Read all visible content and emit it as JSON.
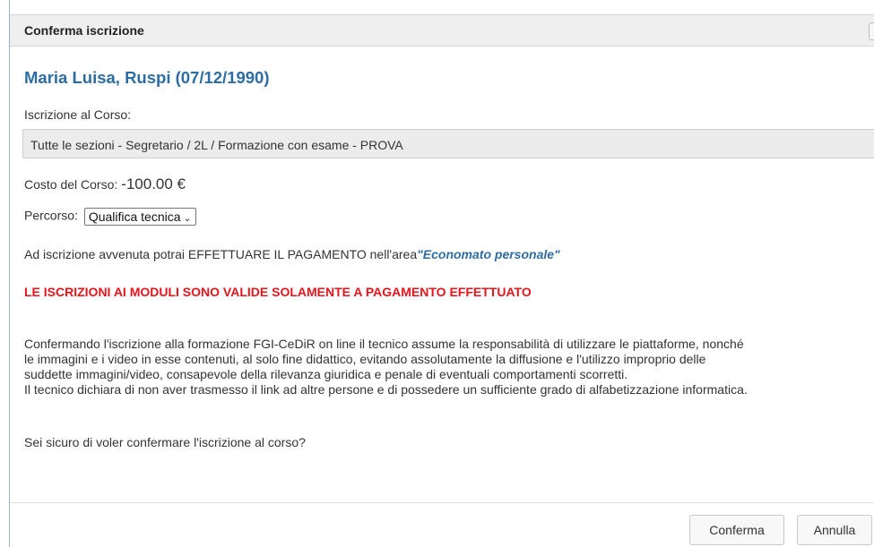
{
  "dialog": {
    "title": "Conferma iscrizione",
    "student_name": "Maria Luisa, Ruspi (07/12/1990)",
    "course_label": "Iscrizione al Corso:",
    "course_value": "Tutte le sezioni - Segretario / 2L / Formazione con esame - PROVA",
    "cost_label": "Costo del Corso: ",
    "cost_value": "-100.00 €",
    "path_label": "Percorso: ",
    "path_selected": "Qualifica tecnica",
    "payment_text": "Ad iscrizione avvenuta potrai EFFETTUARE IL PAGAMENTO nell'area",
    "payment_link": "\"Economato personale\"",
    "warning": "LE ISCRIZIONI AI MODULI SONO VALIDE SOLAMENTE A PAGAMENTO EFFETTUATO",
    "disclaimer_lines": [
      "Confermando l'iscrizione alla formazione FGI-CeDiR on line il tecnico assume la responsabilità di utilizzare le piattaforme, nonché",
      "le immagini e i video in esse contenuti, al solo fine didattico, evitando assolutamente la diffusione e l'utilizzo improprio delle",
      "suddette immagini/video, consapevole della rilevanza giuridica e penale di eventuali comportamenti scorretti.",
      "Il tecnico dichiara di non aver trasmesso il link ad altre persone e di possedere un sufficiente grado di alfabetizzazione informatica."
    ],
    "question": "Sei sicuro di voler confermare l'iscrizione al corso?",
    "confirm_label": "Conferma",
    "cancel_label": "Annulla"
  },
  "colors": {
    "accent": "#2e6da4",
    "warning": "#e8141b",
    "titlebar_bg": "#efefef"
  }
}
